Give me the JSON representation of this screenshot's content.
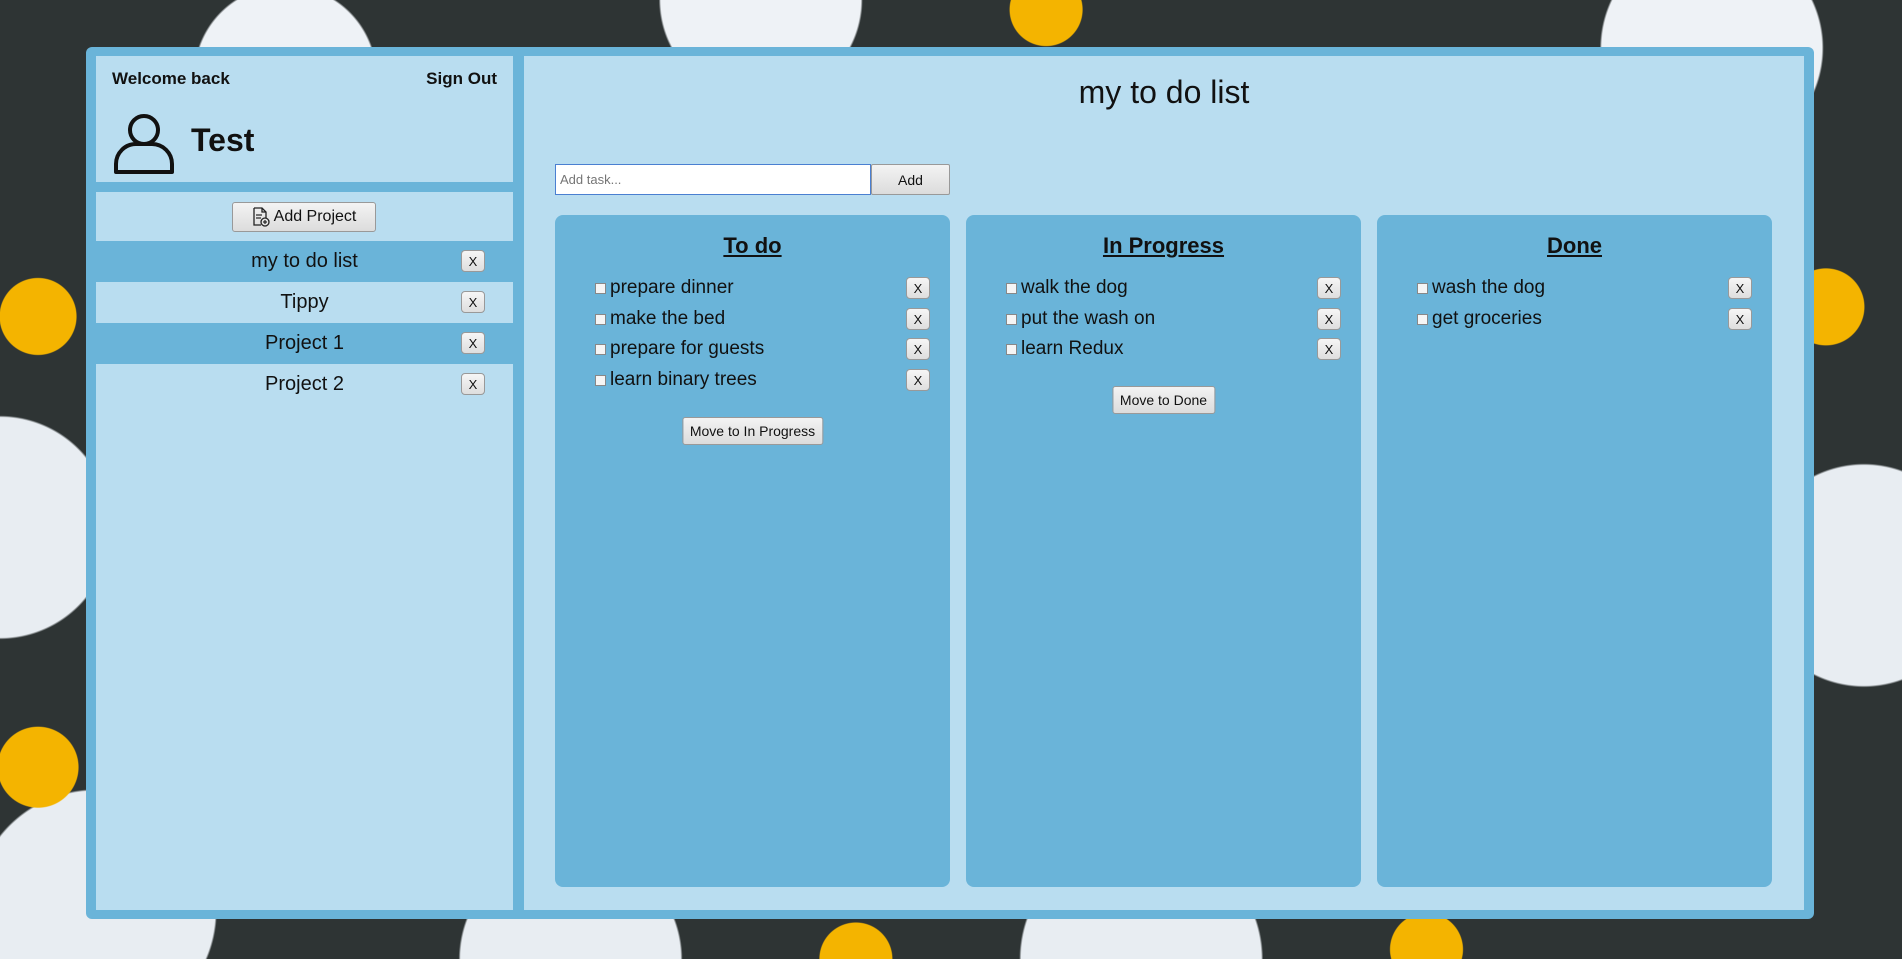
{
  "sidebar": {
    "welcome": "Welcome back",
    "sign_out": "Sign Out",
    "username": "Test",
    "avatar_icon": "user-icon",
    "add_project_label": "Add Project",
    "add_project_icon": "document-add-icon",
    "projects": [
      {
        "name": "my to do list",
        "delete": "X"
      },
      {
        "name": "Tippy",
        "delete": "X"
      },
      {
        "name": "Project 1",
        "delete": "X"
      },
      {
        "name": "Project 2",
        "delete": "X"
      }
    ]
  },
  "main": {
    "title": "my to do list",
    "task_input_placeholder": "Add task...",
    "add_label": "Add",
    "columns": [
      {
        "title": "To do",
        "tasks": [
          "prepare dinner",
          "make the bed",
          "prepare for guests",
          "learn binary trees"
        ],
        "move_label": "Move to In Progress"
      },
      {
        "title": "In Progress",
        "tasks": [
          "walk the dog",
          "put the wash on",
          "learn Redux"
        ],
        "move_label": "Move to Done"
      },
      {
        "title": "Done",
        "tasks": [
          "wash the dog",
          "get groceries"
        ]
      }
    ],
    "delete_label": "X"
  },
  "colors": {
    "frame": "#6ab4d9",
    "panel": "#b9ddf0",
    "accent_border": "#4a7fd1"
  }
}
